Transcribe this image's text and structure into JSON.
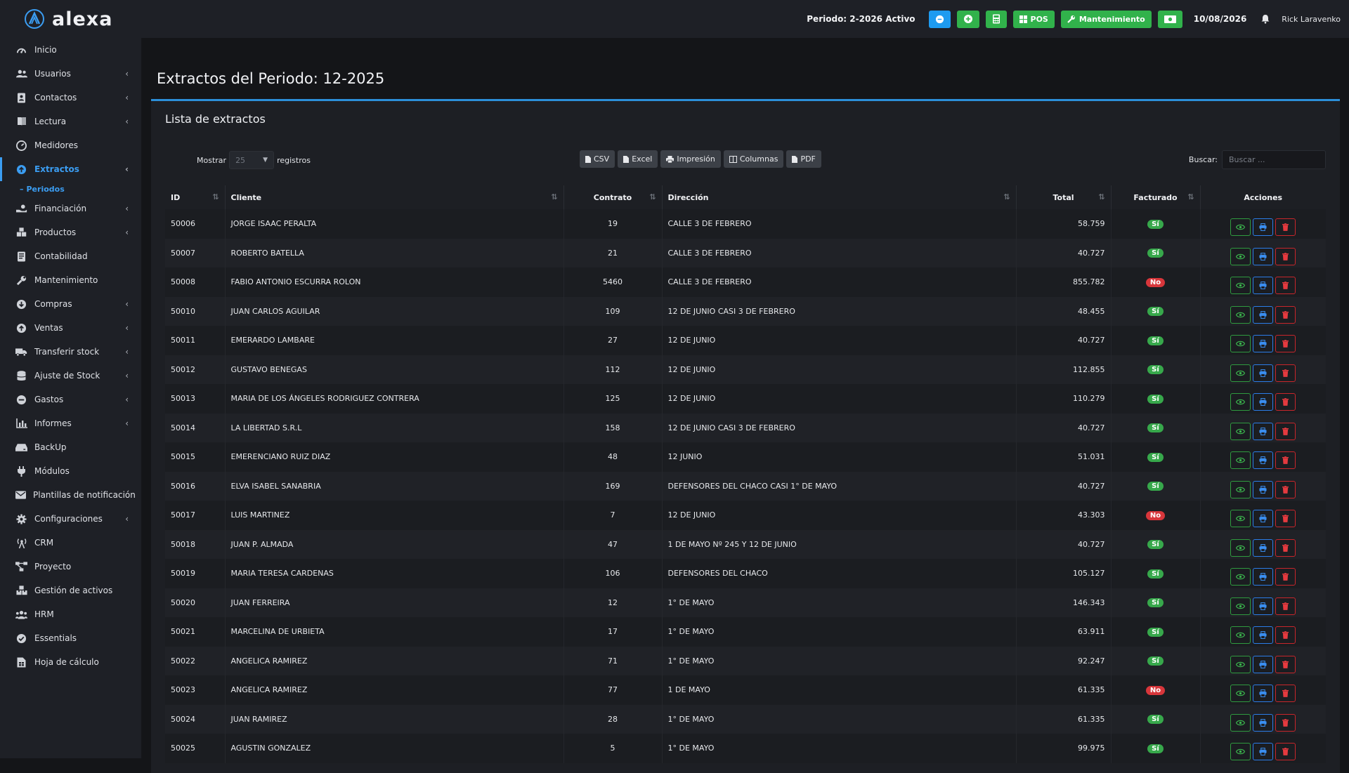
{
  "brand": {
    "name": "alexa"
  },
  "sidebar": {
    "items": [
      {
        "label": "Inicio",
        "icon": "gauge-icon",
        "chevron": false,
        "active": false
      },
      {
        "label": "Usuarios",
        "icon": "users-icon",
        "chevron": true,
        "active": false
      },
      {
        "label": "Contactos",
        "icon": "address-book-icon",
        "chevron": true,
        "active": false
      },
      {
        "label": "Lectura",
        "icon": "book-icon",
        "chevron": true,
        "active": false
      },
      {
        "label": "Medidores",
        "icon": "meter-icon",
        "chevron": false,
        "active": false
      },
      {
        "label": "Extractos",
        "icon": "extract-icon",
        "chevron": true,
        "active": true
      },
      {
        "label": "Financiación",
        "icon": "hand-money-icon",
        "chevron": true,
        "active": false
      },
      {
        "label": "Productos",
        "icon": "cubes-icon",
        "chevron": true,
        "active": false
      },
      {
        "label": "Contabilidad",
        "icon": "ledger-icon",
        "chevron": false,
        "active": false
      },
      {
        "label": "Mantenimiento",
        "icon": "wrench-icon",
        "chevron": false,
        "active": false
      },
      {
        "label": "Compras",
        "icon": "arrow-down-circle-icon",
        "chevron": true,
        "active": false
      },
      {
        "label": "Ventas",
        "icon": "arrow-up-circle-icon",
        "chevron": true,
        "active": false
      },
      {
        "label": "Transferir stock",
        "icon": "truck-icon",
        "chevron": true,
        "active": false
      },
      {
        "label": "Ajuste de Stock",
        "icon": "database-icon",
        "chevron": true,
        "active": false
      },
      {
        "label": "Gastos",
        "icon": "minus-circle-icon",
        "chevron": true,
        "active": false
      },
      {
        "label": "Informes",
        "icon": "bar-chart-icon",
        "chevron": true,
        "active": false
      },
      {
        "label": "BackUp",
        "icon": "hdd-icon",
        "chevron": false,
        "active": false
      },
      {
        "label": "Módulos",
        "icon": "plug-icon",
        "chevron": false,
        "active": false
      },
      {
        "label": "Plantillas de notificación",
        "icon": "envelope-icon",
        "chevron": false,
        "active": false
      },
      {
        "label": "Configuraciones",
        "icon": "gear-icon",
        "chevron": true,
        "active": false
      },
      {
        "label": "CRM",
        "icon": "broadcast-icon",
        "chevron": false,
        "active": false
      },
      {
        "label": "Proyecto",
        "icon": "project-diagram-icon",
        "chevron": false,
        "active": false
      },
      {
        "label": "Gestión de activos",
        "icon": "boxes-icon",
        "chevron": false,
        "active": false
      },
      {
        "label": "HRM",
        "icon": "people-group-icon",
        "chevron": false,
        "active": false
      },
      {
        "label": "Essentials",
        "icon": "check-circle-icon",
        "chevron": false,
        "active": false
      },
      {
        "label": "Hoja de cálculo",
        "icon": "spreadsheet-icon",
        "chevron": false,
        "active": false
      }
    ],
    "sub_items": [
      {
        "label": "Periodos",
        "parent": "Extractos"
      }
    ]
  },
  "topbar": {
    "period_label": "Periodo: 2-2026 Activo",
    "pos_label": "POS",
    "maintenance_label": "Mantenimiento",
    "date": "10/08/2026",
    "user": "Rick Laravenko"
  },
  "page": {
    "title": "Extractos del Periodo: 12-2025",
    "card_title": "Lista de extractos"
  },
  "controls": {
    "show_label": "Mostrar",
    "page_size": "25",
    "records_label": "registros",
    "export_buttons": [
      "CSV",
      "Excel",
      "Impresión",
      "Columnas",
      "PDF"
    ],
    "search_label": "Buscar:",
    "search_placeholder": "Buscar ..."
  },
  "table": {
    "columns": [
      "ID",
      "Cliente",
      "Contrato",
      "Dirección",
      "Total",
      "Facturado",
      "Acciones"
    ],
    "rows": [
      {
        "id": "50006",
        "cliente": "JORGE ISAAC PERALTA",
        "contrato": "19",
        "direccion": "CALLE 3 DE FEBRERO",
        "total": "58.759",
        "facturado": "Sí"
      },
      {
        "id": "50007",
        "cliente": "ROBERTO BATELLA",
        "contrato": "21",
        "direccion": "CALLE 3 DE FEBRERO",
        "total": "40.727",
        "facturado": "Sí"
      },
      {
        "id": "50008",
        "cliente": "FABIO ANTONIO ESCURRA ROLON",
        "contrato": "5460",
        "direccion": "CALLE 3 DE FEBRERO",
        "total": "855.782",
        "facturado": "No"
      },
      {
        "id": "50010",
        "cliente": "JUAN CARLOS AGUILAR",
        "contrato": "109",
        "direccion": "12 DE JUNIO CASI 3 DE FEBRERO",
        "total": "48.455",
        "facturado": "Sí"
      },
      {
        "id": "50011",
        "cliente": "EMERARDO LAMBARE",
        "contrato": "27",
        "direccion": "12 DE JUNIO",
        "total": "40.727",
        "facturado": "Sí"
      },
      {
        "id": "50012",
        "cliente": "GUSTAVO BENEGAS",
        "contrato": "112",
        "direccion": "12 DE JUNIO",
        "total": "112.855",
        "facturado": "Sí"
      },
      {
        "id": "50013",
        "cliente": "MARIA DE LOS ÁNGELES RODRIGUEZ CONTRERA",
        "contrato": "125",
        "direccion": "12 DE JUNIO",
        "total": "110.279",
        "facturado": "Sí"
      },
      {
        "id": "50014",
        "cliente": "LA LIBERTAD S.R.L",
        "contrato": "158",
        "direccion": "12 DE JUNIO CASI 3 DE FEBRERO",
        "total": "40.727",
        "facturado": "Sí"
      },
      {
        "id": "50015",
        "cliente": "EMERENCIANO RUIZ DIAZ",
        "contrato": "48",
        "direccion": "12 JUNIO",
        "total": "51.031",
        "facturado": "Sí"
      },
      {
        "id": "50016",
        "cliente": "ELVA ISABEL SANABRIA",
        "contrato": "169",
        "direccion": "DEFENSORES DEL CHACO CASI 1° DE MAYO",
        "total": "40.727",
        "facturado": "Sí"
      },
      {
        "id": "50017",
        "cliente": "LUIS MARTINEZ",
        "contrato": "7",
        "direccion": "12 DE JUNIO",
        "total": "43.303",
        "facturado": "No"
      },
      {
        "id": "50018",
        "cliente": "JUAN P. ALMADA",
        "contrato": "47",
        "direccion": "1 DE MAYO Nº 245 Y 12 DE JUNIO",
        "total": "40.727",
        "facturado": "Sí"
      },
      {
        "id": "50019",
        "cliente": "MARIA TERESA CARDENAS",
        "contrato": "106",
        "direccion": "DEFENSORES DEL CHACO",
        "total": "105.127",
        "facturado": "Sí"
      },
      {
        "id": "50020",
        "cliente": "JUAN FERREIRA",
        "contrato": "12",
        "direccion": "1° DE MAYO",
        "total": "146.343",
        "facturado": "Sí"
      },
      {
        "id": "50021",
        "cliente": "MARCELINA DE URBIETA",
        "contrato": "17",
        "direccion": "1° DE MAYO",
        "total": "63.911",
        "facturado": "Sí"
      },
      {
        "id": "50022",
        "cliente": "ANGELICA RAMIREZ",
        "contrato": "71",
        "direccion": "1° DE MAYO",
        "total": "92.247",
        "facturado": "Sí"
      },
      {
        "id": "50023",
        "cliente": "ANGELICA RAMIREZ",
        "contrato": "77",
        "direccion": "1 DE MAYO",
        "total": "61.335",
        "facturado": "No"
      },
      {
        "id": "50024",
        "cliente": "JUAN RAMIREZ",
        "contrato": "28",
        "direccion": "1° DE MAYO",
        "total": "61.335",
        "facturado": "Sí"
      },
      {
        "id": "50025",
        "cliente": "AGUSTIN GONZALEZ",
        "contrato": "5",
        "direccion": "1° DE MAYO",
        "total": "99.975",
        "facturado": "Sí"
      }
    ]
  },
  "colors": {
    "accent": "#3b9df2",
    "success": "#37a84b",
    "danger": "#d8363b",
    "primary": "#1e9bf0"
  }
}
